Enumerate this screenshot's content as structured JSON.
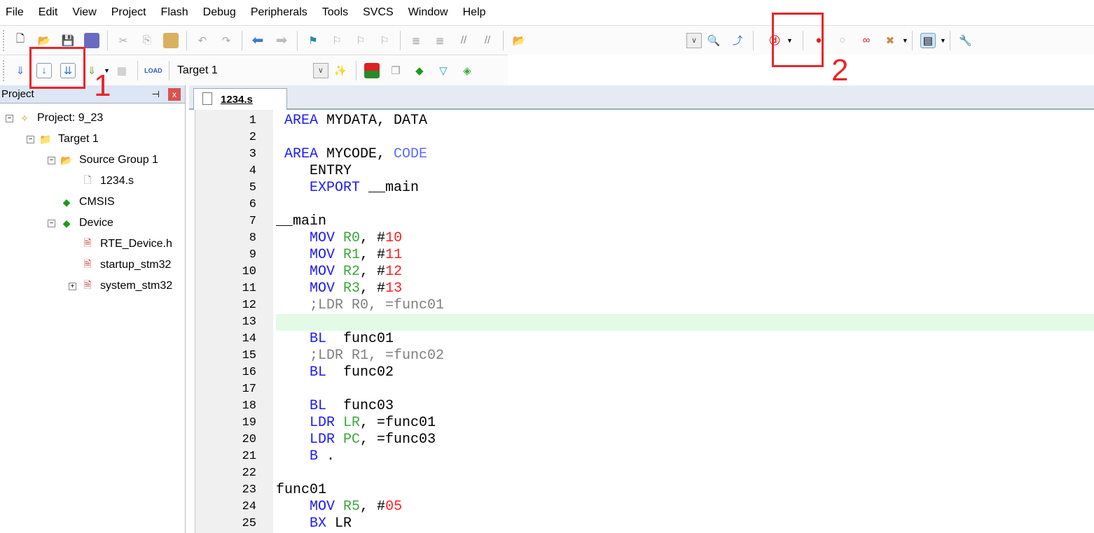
{
  "menu": [
    "File",
    "Edit",
    "View",
    "Project",
    "Flash",
    "Debug",
    "Peripherals",
    "Tools",
    "SVCS",
    "Window",
    "Help"
  ],
  "toolbar2": {
    "target": "Target 1"
  },
  "project": {
    "title": "Project",
    "pin": "⊣",
    "close": "x",
    "tree": [
      {
        "label": "Project: 9_23",
        "level": 0,
        "toggle": "⊟",
        "icon": "project-icon"
      },
      {
        "label": "Target 1",
        "level": 1,
        "toggle": "⊟",
        "icon": "target-folder-icon"
      },
      {
        "label": "Source Group 1",
        "level": 2,
        "toggle": "⊟",
        "icon": "folder-icon"
      },
      {
        "label": "1234.s",
        "level": 3,
        "toggle": "",
        "icon": "file-icon"
      },
      {
        "label": "CMSIS",
        "level": 2,
        "toggle": "",
        "icon": "green-diamond-icon"
      },
      {
        "label": "Device",
        "level": 2,
        "toggle": "⊟",
        "icon": "green-diamond-icon"
      },
      {
        "label": "RTE_Device.h",
        "level": 3,
        "toggle": "",
        "icon": "locked-file-icon"
      },
      {
        "label": "startup_stm32",
        "level": 3,
        "toggle": "",
        "icon": "locked-file-icon"
      },
      {
        "label": "system_stm32",
        "level": 3,
        "toggle": "⊞",
        "icon": "locked-file-icon"
      }
    ]
  },
  "editor": {
    "tab": "1234.s",
    "highlight_line": 13,
    "lines": [
      [
        [
          " AREA",
          "kw"
        ],
        [
          " MYDATA, DATA",
          ""
        ]
      ],
      [],
      [
        [
          " AREA",
          "kw"
        ],
        [
          " MYCODE, ",
          ""
        ],
        [
          "CODE",
          "kw2"
        ]
      ],
      [
        [
          "    ENTRY",
          ""
        ]
      ],
      [
        [
          "    EXPORT",
          "kw"
        ],
        [
          " __main",
          ""
        ]
      ],
      [],
      [
        [
          "__main",
          ""
        ]
      ],
      [
        [
          "    MOV",
          "kw"
        ],
        [
          " ",
          ""
        ],
        [
          "R0",
          "reg"
        ],
        [
          ", #",
          ""
        ],
        [
          "10",
          "num"
        ]
      ],
      [
        [
          "    MOV",
          "kw"
        ],
        [
          " ",
          ""
        ],
        [
          "R1",
          "reg"
        ],
        [
          ", #",
          ""
        ],
        [
          "11",
          "num"
        ]
      ],
      [
        [
          "    MOV",
          "kw"
        ],
        [
          " ",
          ""
        ],
        [
          "R2",
          "reg"
        ],
        [
          ", #",
          ""
        ],
        [
          "12",
          "num"
        ]
      ],
      [
        [
          "    MOV",
          "kw"
        ],
        [
          " ",
          ""
        ],
        [
          "R3",
          "reg"
        ],
        [
          ", #",
          ""
        ],
        [
          "13",
          "num"
        ]
      ],
      [
        [
          "    ;LDR R0, =func01",
          "cm"
        ]
      ],
      [],
      [
        [
          "    BL",
          "kw"
        ],
        [
          "  func01",
          ""
        ]
      ],
      [
        [
          "    ;LDR R1, =func02",
          "cm"
        ]
      ],
      [
        [
          "    BL",
          "kw"
        ],
        [
          "  func02",
          ""
        ]
      ],
      [],
      [
        [
          "    BL",
          "kw"
        ],
        [
          "  func03",
          ""
        ]
      ],
      [
        [
          "    LDR",
          "kw"
        ],
        [
          " ",
          ""
        ],
        [
          "LR",
          "reg"
        ],
        [
          ", =func01",
          ""
        ]
      ],
      [
        [
          "    LDR",
          "kw"
        ],
        [
          " ",
          ""
        ],
        [
          "PC",
          "reg"
        ],
        [
          ", =func03",
          ""
        ]
      ],
      [
        [
          "    B",
          "kw"
        ],
        [
          " .",
          ""
        ]
      ],
      [],
      [
        [
          "func01",
          ""
        ]
      ],
      [
        [
          "    MOV",
          "kw"
        ],
        [
          " ",
          ""
        ],
        [
          "R5",
          "reg"
        ],
        [
          ", #",
          ""
        ],
        [
          "05",
          "num"
        ]
      ],
      [
        [
          "    BX",
          "kw"
        ],
        [
          " LR",
          ""
        ]
      ]
    ]
  },
  "annotations": [
    {
      "label": "1"
    },
    {
      "label": "2"
    }
  ],
  "colors": {
    "annotation": "#e8262b",
    "keyword": "#1a1aff",
    "register": "#3aa83a",
    "number": "#ff2020",
    "comment": "#808080",
    "current_line": "#e3fbe6"
  }
}
